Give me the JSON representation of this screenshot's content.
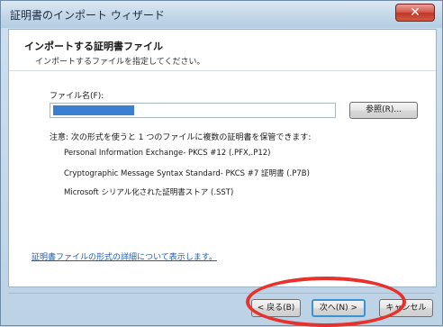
{
  "window": {
    "title": "証明書のインポート ウィザード",
    "close_label": "✕"
  },
  "header": {
    "title": "インポートする証明書ファイル",
    "subtitle": "インポートするファイルを指定してください。"
  },
  "file": {
    "label": "ファイル名(F):",
    "value": "",
    "browse_label": "参照(R)..."
  },
  "note": "注意: 次の形式を使うと 1 つのファイルに複数の証明書を保管できます:",
  "formats": [
    "Personal Information Exchange- PKCS #12 (.PFX,.P12)",
    "Cryptographic Message Syntax Standard- PKCS #7 証明書 (.P7B)",
    "Microsoft シリアル化された証明書ストア (.SST)"
  ],
  "details_link": "証明書ファイルの形式の詳細について表示します。",
  "buttons": {
    "back": "< 戻る(B)",
    "next": "次へ(N) >",
    "cancel": "キャンセル"
  },
  "colors": {
    "accent_blue": "#3b93d4",
    "link_blue": "#1c5fb5",
    "highlight_red": "#e8312a",
    "close_red": "#c0352a"
  }
}
